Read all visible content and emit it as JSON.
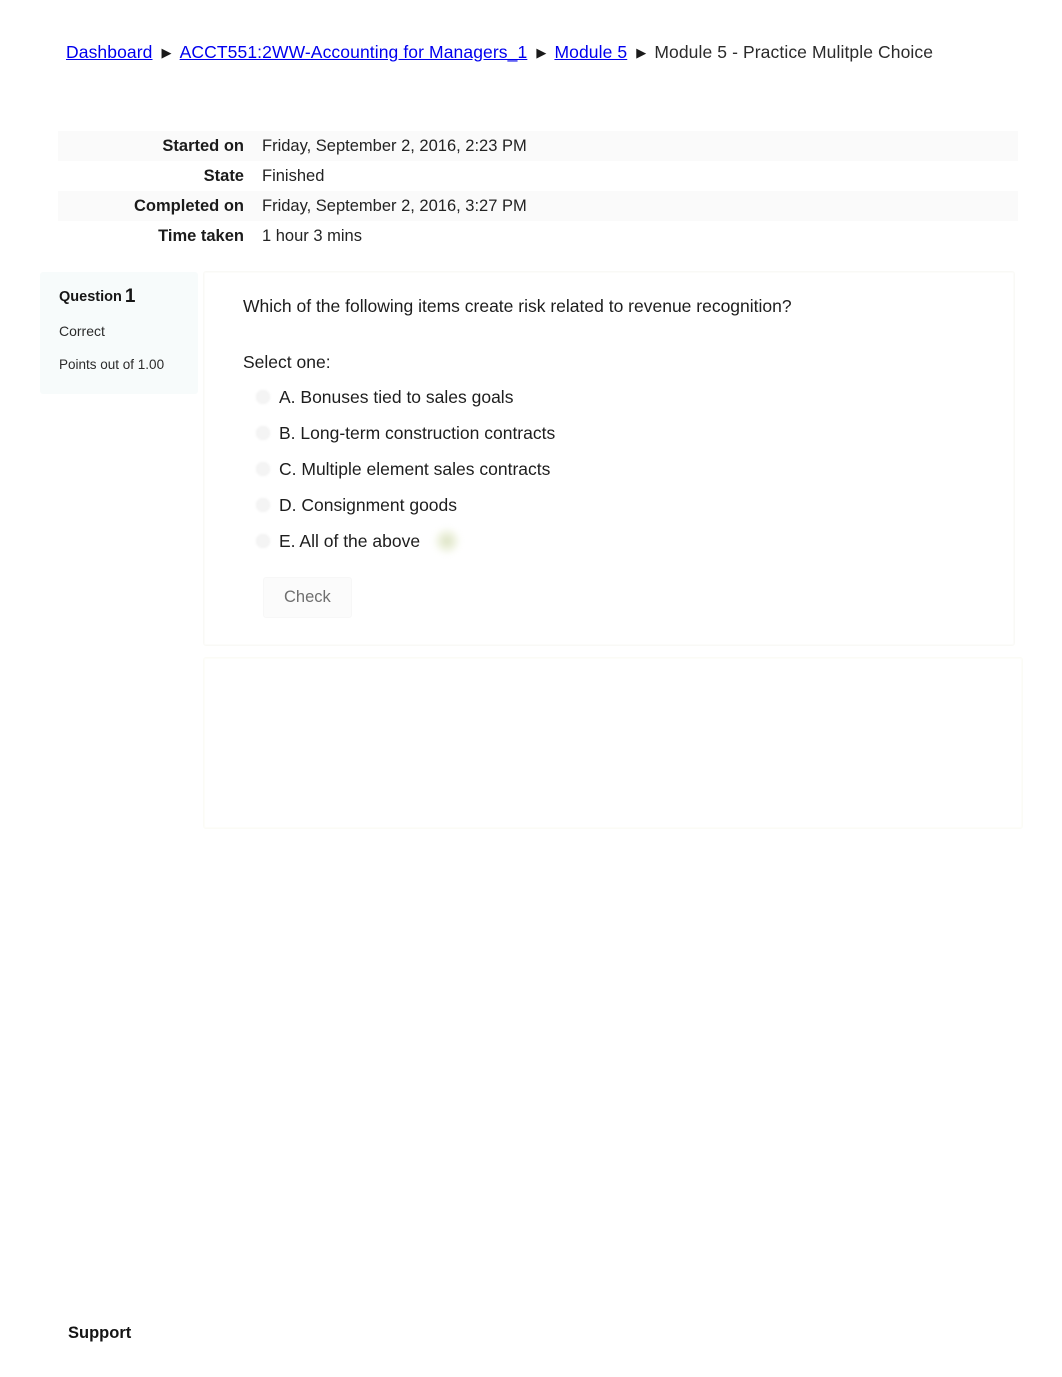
{
  "breadcrumb": {
    "separator_icon": "triangle-right-icon",
    "items": [
      {
        "label": "Dashboard"
      },
      {
        "label": "ACCT551:2WW-Accounting for Managers_1"
      },
      {
        "label": "Module 5"
      },
      {
        "label": "Module 5 - Practice Mulitple Choice"
      }
    ]
  },
  "summary": {
    "rows": [
      {
        "label": "Started on",
        "value": "Friday, September 2, 2016, 2:23 PM"
      },
      {
        "label": "State",
        "value": "Finished"
      },
      {
        "label": "Completed on",
        "value": "Friday, September 2, 2016, 3:27 PM"
      },
      {
        "label": "Time taken",
        "value": "1 hour 3 mins"
      }
    ]
  },
  "question": {
    "number_label": "Question",
    "number": "1",
    "state": "Correct",
    "grade": "Points out of 1.00",
    "text": "Which of the following items create risk related to revenue recognition?",
    "select_prompt": "Select one:",
    "answers": [
      {
        "label": "A. Bonuses tied to sales goals",
        "correct": false
      },
      {
        "label": "B. Long-term construction contracts",
        "correct": false
      },
      {
        "label": "C. Multiple element sales contracts",
        "correct": false
      },
      {
        "label": "D. Consignment goods",
        "correct": false
      },
      {
        "label": "E. All of the above",
        "correct": true
      }
    ],
    "check_label": "Check"
  },
  "footer": {
    "support_label": "Support"
  },
  "colors": {
    "page_background": "#ffffff",
    "question_info_background": "#f7fbfb",
    "table_stripe": "#fafafa",
    "text": "#1d1d1d",
    "muted_text": "#6f6f6f",
    "correct_marker": "#d6deba"
  }
}
